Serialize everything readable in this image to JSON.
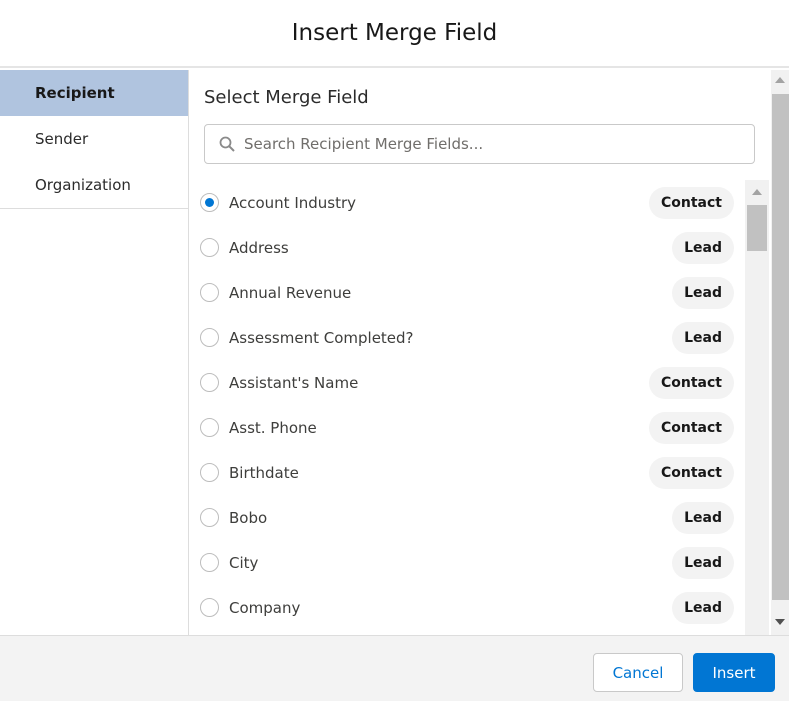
{
  "dialog": {
    "title": "Insert Merge Field"
  },
  "sidebar": {
    "items": [
      {
        "label": "Recipient",
        "active": true
      },
      {
        "label": "Sender"
      },
      {
        "label": "Organization"
      }
    ]
  },
  "main": {
    "heading": "Select Merge Field",
    "search_placeholder": "Search Recipient Merge Fields...",
    "fields": [
      {
        "label": "Account Industry",
        "type": "Contact",
        "selected": true
      },
      {
        "label": "Address",
        "type": "Lead"
      },
      {
        "label": "Annual Revenue",
        "type": "Lead"
      },
      {
        "label": "Assessment Completed?",
        "type": "Lead"
      },
      {
        "label": "Assistant's Name",
        "type": "Contact"
      },
      {
        "label": "Asst. Phone",
        "type": "Contact"
      },
      {
        "label": "Birthdate",
        "type": "Contact"
      },
      {
        "label": "Bobo",
        "type": "Lead"
      },
      {
        "label": "City",
        "type": "Lead"
      },
      {
        "label": "Company",
        "type": "Lead"
      }
    ]
  },
  "footer": {
    "cancel_label": "Cancel",
    "insert_label": "Insert"
  },
  "colors": {
    "accent": "#0176d3",
    "active_tab": "#b0c4df"
  }
}
